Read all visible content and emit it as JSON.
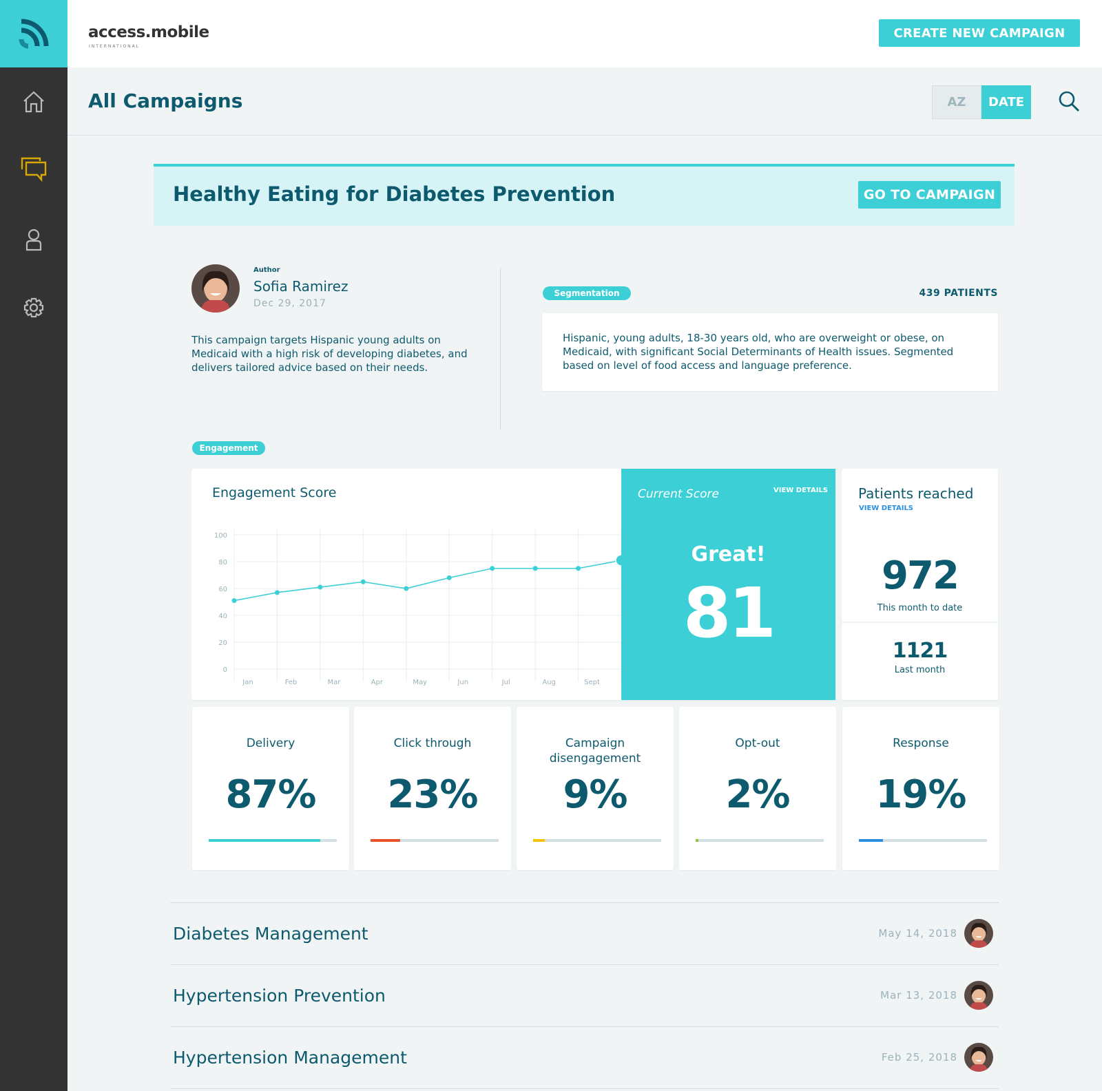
{
  "brand": {
    "name": "access.mobile",
    "sub": "INTERNATIONAL"
  },
  "header": {
    "create_label": "CREATE NEW CAMPAIGN",
    "page_title": "All Campaigns",
    "sort_az": "AZ",
    "sort_date": "DATE",
    "active_sort": "DATE"
  },
  "sidebar": {
    "items": [
      {
        "icon": "home-icon"
      },
      {
        "icon": "chat-icon",
        "active": true
      },
      {
        "icon": "user-icon"
      },
      {
        "icon": "gear-icon"
      }
    ],
    "active_color": "#d9a800"
  },
  "campaign": {
    "title": "Healthy Eating for Diabetes Prevention",
    "go_label": "GO TO CAMPAIGN",
    "author_label": "Author",
    "author": "Sofia Ramirez",
    "date": "Dec 29, 2017",
    "description": "This campaign targets Hispanic young adults on Medicaid with a high risk of developing diabetes, and delivers tailored advice based on their needs.",
    "segmentation_label": "Segmentation",
    "patients": "439 PATIENTS",
    "segmentation": "Hispanic, young adults, 18-30 years old, who are overweight or obese, on Medicaid, with significant Social Determinants of Health issues. Segmented based on level of food access and language preference.",
    "engagement_label": "Engagement"
  },
  "engagement": {
    "title": "Engagement Score"
  },
  "chart_data": {
    "type": "line",
    "title": "Engagement Score",
    "categories": [
      "Jan",
      "Feb",
      "Mar",
      "Apr",
      "May",
      "Jun",
      "Jul",
      "Aug",
      "Sept",
      ""
    ],
    "values": [
      51,
      57,
      61,
      65,
      60,
      68,
      75,
      75,
      75,
      81
    ],
    "yticks": [
      0,
      20,
      40,
      60,
      80,
      100
    ],
    "ylim": [
      0,
      100
    ],
    "grid": true,
    "color": "#3ccfd6"
  },
  "current_score": {
    "label": "Current Score",
    "view_details": "VIEW DETAILS",
    "rating": "Great!",
    "score": "81"
  },
  "patients_reached": {
    "title": "Patients reached",
    "view_details": "VIEW DETAILS",
    "this_month": "972",
    "this_month_label": "This month to date",
    "last_month": "1121",
    "last_month_label": "Last month"
  },
  "metrics": [
    {
      "title": "Delivery",
      "value": "87%",
      "percent": 87,
      "color": "#3ccfd6"
    },
    {
      "title": "Click through",
      "value": "23%",
      "percent": 23,
      "color": "#e8522a"
    },
    {
      "title": "Campaign disengagement",
      "value": "9%",
      "percent": 9,
      "color": "#f5c400"
    },
    {
      "title": "Opt-out",
      "value": "2%",
      "percent": 2,
      "color": "#8dc63f"
    },
    {
      "title": "Response",
      "value": "19%",
      "percent": 19,
      "color": "#2b8fe0"
    }
  ],
  "campaign_list": [
    {
      "title": "Diabetes Management",
      "date": "May 14, 2018"
    },
    {
      "title": "Hypertension Prevention",
      "date": "Mar 13, 2018"
    },
    {
      "title": "Hypertension Management",
      "date": "Feb 25, 2018"
    }
  ]
}
